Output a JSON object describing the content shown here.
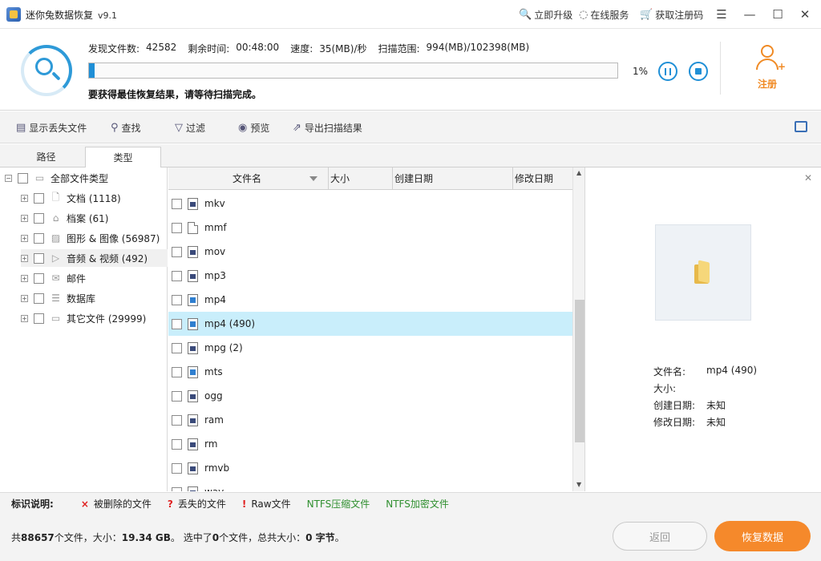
{
  "titlebar": {
    "title": "迷你兔数据恢复",
    "version": "v9.1",
    "upgrade": "立即升级",
    "online": "在线服务",
    "get_code": "获取注册码"
  },
  "scan": {
    "found_label": "发现文件数:",
    "found_value": "42582",
    "remain_label": "剩余时间:",
    "remain_value": "00:48:00",
    "speed_label": "速度:",
    "speed_value": "35(MB)/秒",
    "range_label": "扫描范围:",
    "range_value": "994(MB)/102398(MB)",
    "progress_percent": 1,
    "percent_text": "1%",
    "hint": "要获得最佳恢复结果，请等待扫描完成。"
  },
  "register": {
    "label": "注册"
  },
  "toolbar": {
    "show_lost": "显示丢失文件",
    "find": "查找",
    "filter": "过滤",
    "preview": "预览",
    "export": "导出扫描结果"
  },
  "tabs": {
    "path": "路径",
    "type": "类型"
  },
  "tree": {
    "root": "全部文件类型",
    "items": [
      {
        "label": "文档 (1118)",
        "icon": "document-icon"
      },
      {
        "label": "档案 (61)",
        "icon": "archive-icon"
      },
      {
        "label": "图形 & 图像 (56987)",
        "icon": "image-icon"
      },
      {
        "label": "音频 & 视频 (492)",
        "icon": "media-icon"
      },
      {
        "label": "邮件",
        "icon": "mail-icon"
      },
      {
        "label": "数据库",
        "icon": "database-icon"
      },
      {
        "label": "其它文件 (29999)",
        "icon": "folder-icon"
      }
    ]
  },
  "list": {
    "columns": {
      "name": "文件名",
      "size": "大小",
      "created": "创建日期",
      "modified": "修改日期"
    },
    "rows": [
      {
        "name": "mkv"
      },
      {
        "name": "mmf"
      },
      {
        "name": "mov"
      },
      {
        "name": "mp3"
      },
      {
        "name": "mp4"
      },
      {
        "name": "mp4 (490)"
      },
      {
        "name": "mpg (2)"
      },
      {
        "name": "mts"
      },
      {
        "name": "ogg"
      },
      {
        "name": "ram"
      },
      {
        "name": "rm"
      },
      {
        "name": "rmvb"
      },
      {
        "name": "wav"
      }
    ]
  },
  "preview": {
    "name_label": "文件名:",
    "name_value": "mp4 (490)",
    "size_label": "大小:",
    "size_value": "",
    "created_label": "创建日期:",
    "created_value": "未知",
    "modified_label": "修改日期:",
    "modified_value": "未知"
  },
  "legend": {
    "title": "标识说明:",
    "deleted": "被删除的文件",
    "lost": "丢失的文件",
    "raw": "Raw文件",
    "ntfs_compressed": "NTFS压缩文件",
    "ntfs_encrypted": "NTFS加密文件",
    "mark_x": "×",
    "mark_q": "?",
    "mark_ex": "!"
  },
  "status": {
    "t1": "共",
    "total_files": "88657",
    "t2": "个文件，大小：",
    "total_size": "19.34 GB",
    "t3": "。 选中了",
    "selected": "0",
    "t4": "个文件，总共大小：",
    "selected_size": "0 字节",
    "t5": "。"
  },
  "buttons": {
    "back": "返回",
    "recover": "恢复数据"
  },
  "colors": {
    "accent": "#1f8fd6",
    "orange": "#f5892b",
    "selection": "#c9eefb"
  }
}
